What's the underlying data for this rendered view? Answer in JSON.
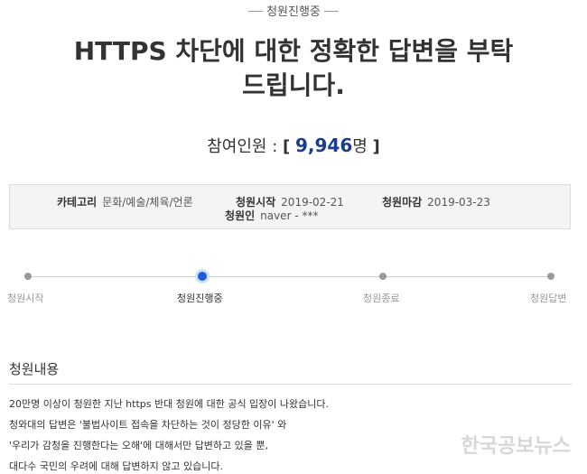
{
  "status_top": "청원진행중",
  "title_line1": "HTTPS 차단에 대한 정확한 답변을 부탁",
  "title_line2": "드립니다.",
  "participants": {
    "label": "참여인원 :",
    "open": "[",
    "count": "9,946",
    "unit": "명",
    "close": "]"
  },
  "info": {
    "category_label": "카테고리",
    "category_value": "문화/예술/체육/언론",
    "start_label": "청원시작",
    "start_value": "2019-02-21",
    "end_label": "청원마감",
    "end_value": "2019-03-23",
    "petitioner_label": "청원인",
    "petitioner_value": "naver - ***"
  },
  "steps": [
    {
      "label": "청원시작",
      "active": false
    },
    {
      "label": "청원진행중",
      "active": true
    },
    {
      "label": "청원종료",
      "active": false
    },
    {
      "label": "청원답변",
      "active": false
    }
  ],
  "section_title": "청원내용",
  "content": [
    "20만명 이상이 청원한 지난 https 반대 청원에 대한 공식 입장이 나왔습니다.",
    "청와대의 답변은 '불법사이트 접속을 차단하는 것이 정당한 이유' 와",
    "'우리가 감청을 진행한다는 오해'에 대해서만 답변하고 있을 뿐,",
    "대다수 국민의 우려에 대해 답변하지 않고 있습니다."
  ],
  "watermark": "한국공보뉴스",
  "colors": {
    "accent": "#1a5dd6",
    "count": "#1b3e8c"
  }
}
